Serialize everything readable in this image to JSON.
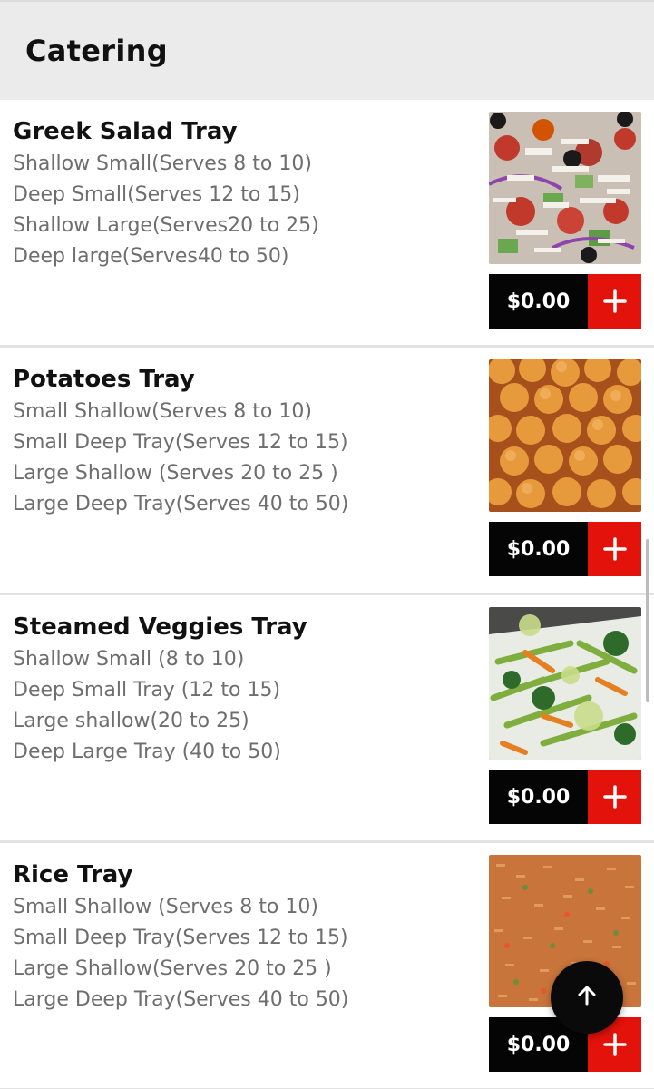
{
  "header": {
    "title": "Catering"
  },
  "items": [
    {
      "title": "Greek Salad Tray",
      "options": [
        "Shallow Small(Serves 8 to 10)",
        "Deep Small(Serves 12 to 15)",
        "Shallow Large(Serves20 to 25)",
        "Deep large(Serves40 to 50)"
      ],
      "price": "$0.00",
      "image": "greek-salad-photo"
    },
    {
      "title": "Potatoes Tray",
      "options": [
        "Small Shallow(Serves 8 to 10)",
        "Small Deep Tray(Serves 12 to 15)",
        "Large Shallow (Serves 20 to 25 )",
        "Large Deep Tray(Serves 40 to 50)"
      ],
      "price": "$0.00",
      "image": "potatoes-photo"
    },
    {
      "title": "Steamed Veggies Tray",
      "options": [
        "Shallow Small (8 to 10)",
        "Deep Small Tray (12 to 15)",
        "Large shallow(20 to 25)",
        "Deep Large Tray (40 to 50)"
      ],
      "price": "$0.00",
      "image": "steamed-veggies-photo"
    },
    {
      "title": "Rice Tray",
      "options": [
        "Small Shallow (Serves 8 to 10)",
        "Small Deep Tray(Serves 12 to 15)",
        "Large Shallow(Serves 20 to 25 )",
        "Large Deep Tray(Serves 40 to 50)"
      ],
      "price": "$0.00",
      "image": "rice-photo"
    }
  ],
  "icons": {
    "add": "plus-icon",
    "scroll_top": "arrow-up-icon"
  },
  "colors": {
    "price_bg": "#050505",
    "add_bg": "#e3120b",
    "header_bg": "#ebebeb",
    "fab_bg": "#0a0a0a"
  }
}
